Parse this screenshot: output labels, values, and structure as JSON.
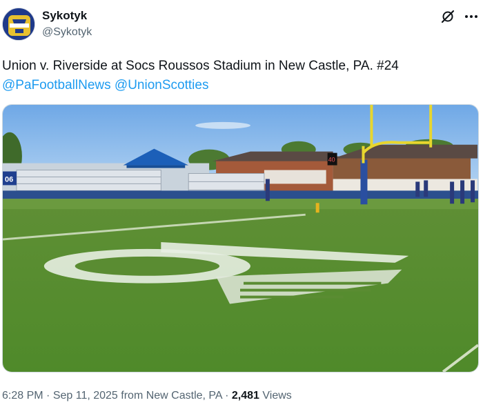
{
  "author": {
    "display_name": "Sykotyk",
    "handle": "@Sykotyk",
    "avatar_icon": "avatar-icon",
    "avatar_color": "#2a3f8f"
  },
  "toolbar": {
    "grok_icon": "grok-icon",
    "more_icon": "more-icon"
  },
  "tweet": {
    "text": "Union v. Riverside at Socs Roussos Stadium in New Castle, PA. #24",
    "mention_1": "@PaFootballNews",
    "mention_2": "@UnionScotties"
  },
  "media": {
    "scoreboard": "40",
    "banner_number": "06",
    "link_color": "#1d9bf0"
  },
  "meta": {
    "time": "6:28 PM",
    "separator_1": " · ",
    "date": "Sep 11, 2025",
    "from_text": " from ",
    "location": "New Castle, PA",
    "separator_2": " · ",
    "views_count": "2,481",
    "views_label": " Views"
  }
}
